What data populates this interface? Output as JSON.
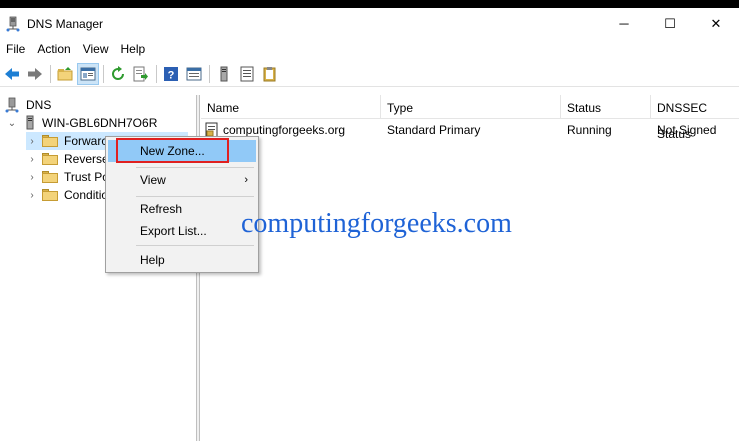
{
  "window": {
    "title": "DNS Manager",
    "icons": {
      "app": "dns-manager-icon"
    },
    "controls": {
      "minimize": "─",
      "maximize": "☐",
      "close": "✕"
    }
  },
  "menu": [
    "File",
    "Action",
    "View",
    "Help"
  ],
  "toolbar": {
    "buttons": [
      "back-arrow",
      "forward-arrow",
      "up-folder",
      "show-hide-console-tree",
      "refresh",
      "export-list",
      "help",
      "properties",
      "server",
      "list",
      "clipboard"
    ]
  },
  "tree": {
    "root": "DNS",
    "server": "WIN-GBL6DNH7O6R",
    "items": [
      "Forwarc",
      "Reverse",
      "Trust Po",
      "Conditio"
    ]
  },
  "list": {
    "columns": [
      "Name",
      "Type",
      "Status",
      "DNSSEC Status"
    ],
    "rows": [
      {
        "name": "computingforgeeks.org",
        "type": "Standard Primary",
        "status": "Running",
        "dnssec": "Not Signed"
      }
    ]
  },
  "context_menu": {
    "items": [
      "New Zone...",
      "View",
      "Refresh",
      "Export List...",
      "Help"
    ],
    "highlighted": "New Zone...",
    "submenu_arrow": "›"
  },
  "watermark": "computingforgeeks.com",
  "colors": {
    "highlight": "#91c9f7",
    "annotation_box": "#e02020",
    "watermark": "#1f63d6"
  }
}
